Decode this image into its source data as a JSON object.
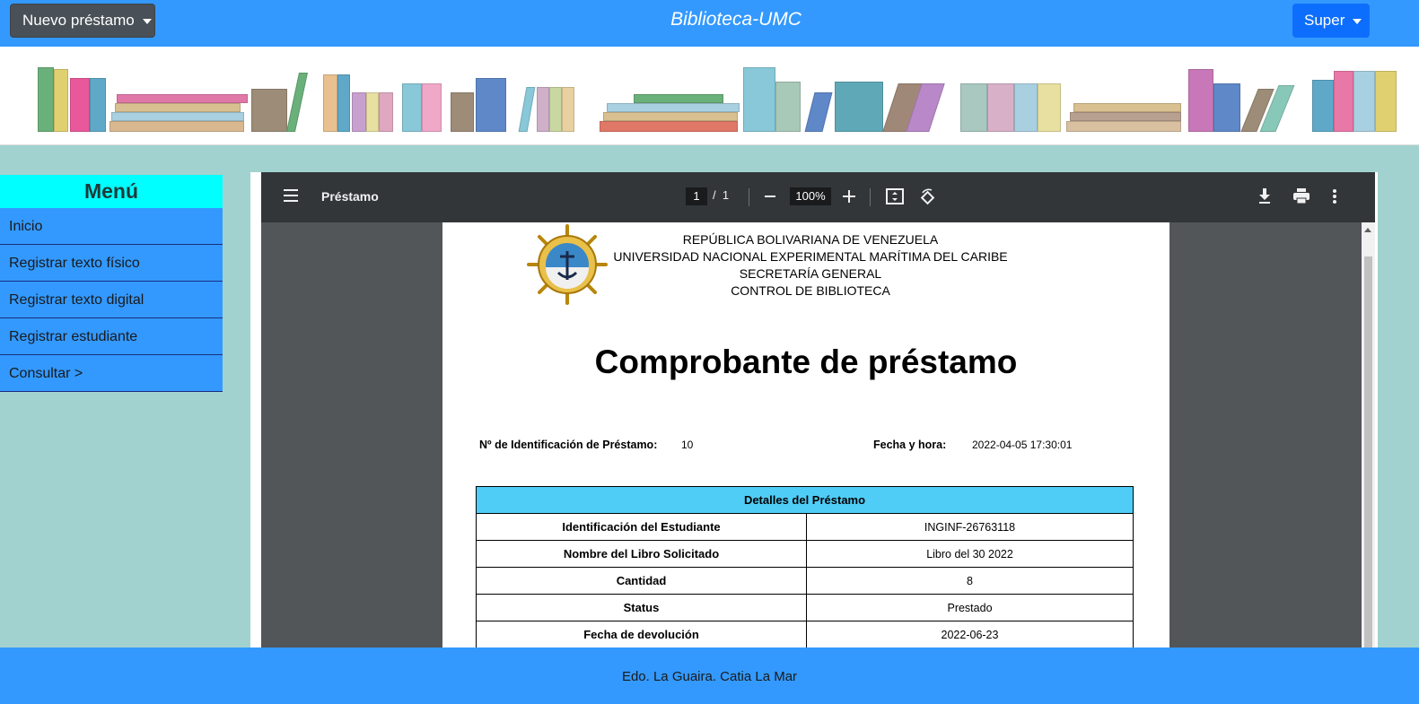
{
  "navbar": {
    "new_loan_label": "Nuevo préstamo",
    "brand": "Biblioteca-UMC",
    "user_label": "Super"
  },
  "sidebar": {
    "title": "Menú",
    "items": [
      {
        "label": "Inicio"
      },
      {
        "label": "Registrar texto físico"
      },
      {
        "label": "Registrar texto digital"
      },
      {
        "label": "Registrar estudiante"
      },
      {
        "label": "Consultar >"
      }
    ]
  },
  "pdf_viewer": {
    "title": "Préstamo",
    "current_page": "1",
    "total_pages": "1",
    "zoom": "100%",
    "icons": [
      "menu-icon",
      "zoom-out-icon",
      "zoom-in-icon",
      "fit-page-icon",
      "rotate-icon",
      "download-icon",
      "print-icon",
      "more-icon"
    ]
  },
  "document": {
    "header_lines": [
      "REPÚBLICA BOLIVARIANA DE VENEZUELA",
      "UNIVERSIDAD NACIONAL EXPERIMENTAL MARÍTIMA DEL CARIBE",
      "SECRETARÍA GENERAL",
      "CONTROL DE BIBLIOTECA"
    ],
    "heading": "Comprobante de préstamo",
    "id_label": "Nº de Identificación de Préstamo:",
    "id_value": "10",
    "date_label": "Fecha y hora:",
    "date_value": "2022-04-05 17:30:01",
    "table_title": "Detalles del Préstamo",
    "rows": [
      {
        "label": "Identificación del Estudiante",
        "value": "INGINF-26763118"
      },
      {
        "label": "Nombre del Libro Solicitado",
        "value": "Libro del 30 2022"
      },
      {
        "label": "Cantidad",
        "value": "8"
      },
      {
        "label": "Status",
        "value": "Prestado"
      },
      {
        "label": "Fecha de devolución",
        "value": "2022-06-23"
      }
    ]
  },
  "footer": {
    "text": "Edo. La Guaira. Catia La Mar"
  },
  "colors": {
    "navbar": "#3399ff",
    "background": "#a2d2cf",
    "menu_title": "#00ffff",
    "table_header": "#4fcdf7",
    "viewer_toolbar": "#323639"
  }
}
